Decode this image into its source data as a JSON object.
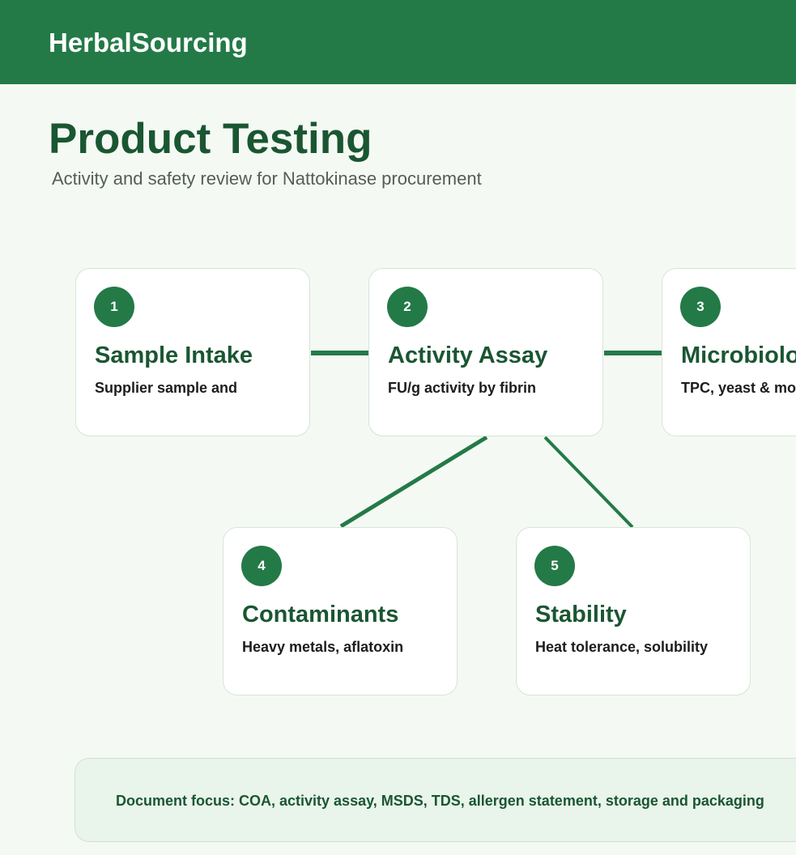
{
  "header": {
    "brand": "HerbalSourcing"
  },
  "page": {
    "title": "Product Testing",
    "subtitle": "Activity and safety review for Nattokinase procurement"
  },
  "steps": [
    {
      "number": "1",
      "title": "Sample Intake",
      "description": "Supplier sample and"
    },
    {
      "number": "2",
      "title": "Activity Assay",
      "description": "FU/g activity by fibrin"
    },
    {
      "number": "3",
      "title": "Microbiology",
      "description": "TPC, yeast & mold"
    },
    {
      "number": "4",
      "title": "Contaminants",
      "description": "Heavy metals, aflatoxin"
    },
    {
      "number": "5",
      "title": "Stability",
      "description": "Heat tolerance, solubility"
    }
  ],
  "footer_note": {
    "text": "Document focus: COA, activity assay, MSDS, TDS, allergen statement, storage and packaging"
  },
  "colors": {
    "brand_green": "#237a47",
    "title_green": "#1a5632",
    "background": "#f5f9f3",
    "note_background": "#e9f4eb"
  }
}
